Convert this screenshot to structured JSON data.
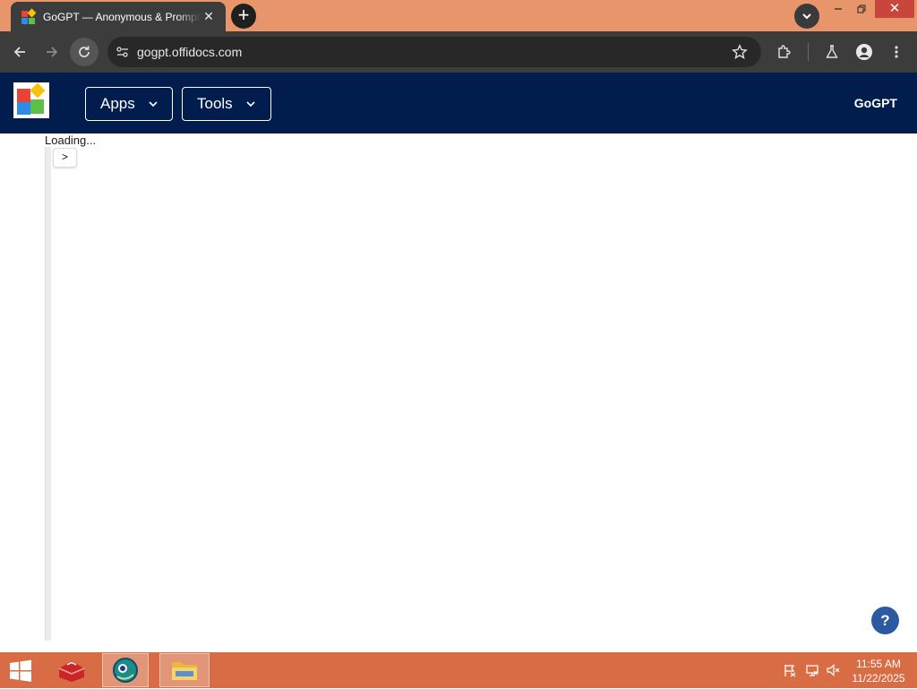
{
  "browser": {
    "tab_title": "GoGPT — Anonymous & Prompt Generator",
    "tab_close": "✕",
    "new_tab": "+",
    "url": "gogpt.offidocs.com",
    "window_close": "✕"
  },
  "site": {
    "nav": {
      "apps_label": "Apps",
      "tools_label": "Tools"
    },
    "brand": "GoGPT"
  },
  "content": {
    "loading_text": "Loading...",
    "expand_label": ">",
    "help_label": "?"
  },
  "taskbar": {
    "time": "11:55 AM",
    "date": "11/22/2025"
  },
  "colors": {
    "tab_strip": "#e8956b",
    "toolbar": "#3c3c3c",
    "site_header": "#001d4d",
    "taskbar": "#d86c45",
    "help_button": "#2c5aa0"
  }
}
